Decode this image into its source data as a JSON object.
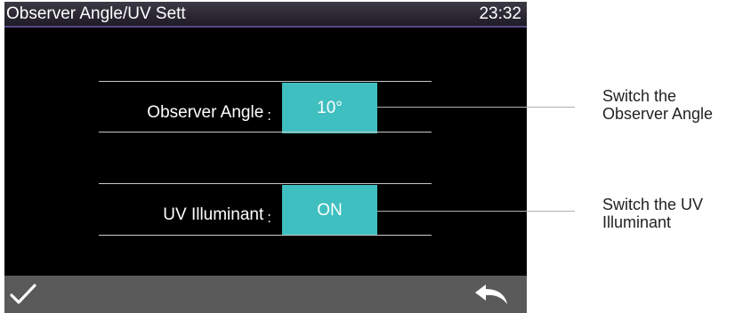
{
  "titlebar": {
    "title": "Observer Angle/UV Sett",
    "time": "23:32"
  },
  "settings": [
    {
      "label": "Observer Angle",
      "separator": ":",
      "value": "10°"
    },
    {
      "label": "UV Illuminant",
      "separator": ":",
      "value": "ON"
    }
  ],
  "bottombar": {
    "confirm_icon": "checkmark-icon",
    "back_icon": "back-arrow-icon"
  },
  "callouts": [
    {
      "line1": "Switch the",
      "line2": "Observer Angle"
    },
    {
      "line1": "Switch the UV",
      "line2": "Illuminant"
    }
  ],
  "colors": {
    "accent": "#3fbfbf",
    "background": "#000000",
    "bottombar": "#5a5a5a",
    "title_underline": "#5a4a8a"
  }
}
